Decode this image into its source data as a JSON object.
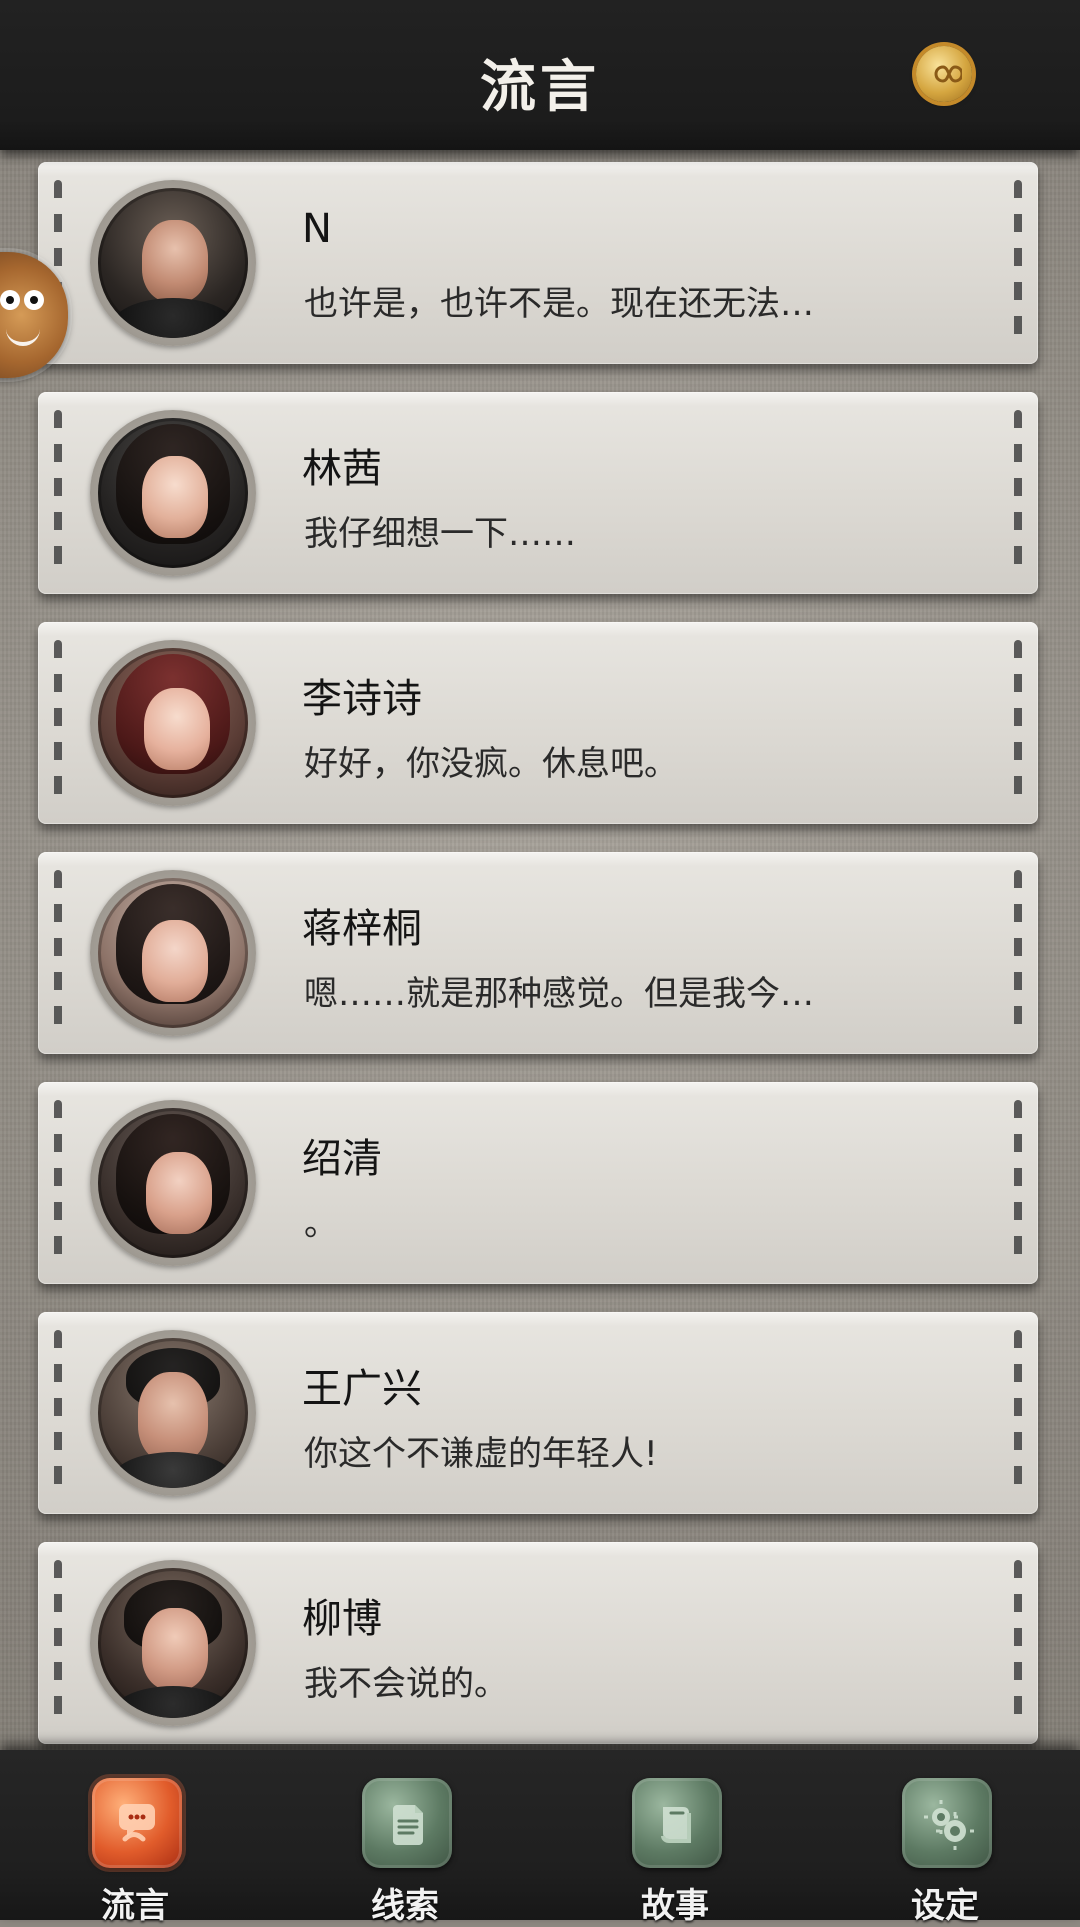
{
  "header": {
    "title": "流言",
    "coin_icon": "infinity-coin-icon"
  },
  "side_badge": {
    "icon": "mascot-face-icon"
  },
  "messages": [
    {
      "name": "N",
      "preview": "也许是，也许不是。现在还无法…"
    },
    {
      "name": "林茜",
      "preview": "我仔细想一下……"
    },
    {
      "name": "李诗诗",
      "preview": "好好，你没疯。休息吧。"
    },
    {
      "name": "蒋梓桐",
      "preview": "嗯……就是那种感觉。但是我今…"
    },
    {
      "name": "绍清",
      "preview": "。"
    },
    {
      "name": "王广兴",
      "preview": "你这个不谦虚的年轻人!"
    },
    {
      "name": "柳博",
      "preview": "我不会说的。"
    }
  ],
  "bottom_nav": {
    "items": [
      {
        "label": "流言",
        "icon": "chat-bubble-icon",
        "active": true
      },
      {
        "label": "线索",
        "icon": "paper-icon",
        "active": false
      },
      {
        "label": "故事",
        "icon": "book-icon",
        "active": false
      },
      {
        "label": "设定",
        "icon": "gears-icon",
        "active": false
      }
    ]
  },
  "colors": {
    "accent_active": "#e15c2b",
    "nav_inactive": "#5d7a63"
  }
}
